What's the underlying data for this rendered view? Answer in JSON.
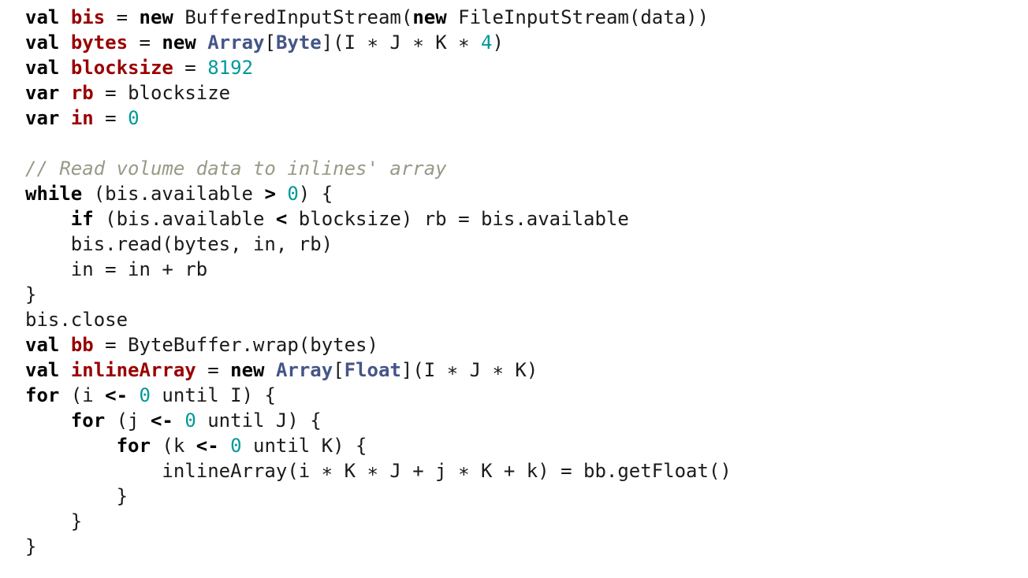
{
  "code": {
    "lines": [
      [
        {
          "t": "val",
          "c": "kw"
        },
        {
          "t": " ",
          "c": "tx"
        },
        {
          "t": "bis",
          "c": "id"
        },
        {
          "t": " = ",
          "c": "tx"
        },
        {
          "t": "new",
          "c": "kw"
        },
        {
          "t": " BufferedInputStream(",
          "c": "tx"
        },
        {
          "t": "new",
          "c": "kw"
        },
        {
          "t": " FileInputStream(data))",
          "c": "tx"
        }
      ],
      [
        {
          "t": "val",
          "c": "kw"
        },
        {
          "t": " ",
          "c": "tx"
        },
        {
          "t": "bytes",
          "c": "id"
        },
        {
          "t": " = ",
          "c": "tx"
        },
        {
          "t": "new",
          "c": "kw"
        },
        {
          "t": " ",
          "c": "tx"
        },
        {
          "t": "Array",
          "c": "ty"
        },
        {
          "t": "[",
          "c": "tx"
        },
        {
          "t": "Byte",
          "c": "ty"
        },
        {
          "t": "](I ∗ J ∗ K ∗ ",
          "c": "tx"
        },
        {
          "t": "4",
          "c": "num"
        },
        {
          "t": ")",
          "c": "tx"
        }
      ],
      [
        {
          "t": "val",
          "c": "kw"
        },
        {
          "t": " ",
          "c": "tx"
        },
        {
          "t": "blocksize",
          "c": "id"
        },
        {
          "t": " = ",
          "c": "tx"
        },
        {
          "t": "8192",
          "c": "num"
        }
      ],
      [
        {
          "t": "var",
          "c": "kw"
        },
        {
          "t": " ",
          "c": "tx"
        },
        {
          "t": "rb",
          "c": "id"
        },
        {
          "t": " = blocksize",
          "c": "tx"
        }
      ],
      [
        {
          "t": "var",
          "c": "kw"
        },
        {
          "t": " ",
          "c": "tx"
        },
        {
          "t": "in",
          "c": "id"
        },
        {
          "t": " = ",
          "c": "tx"
        },
        {
          "t": "0",
          "c": "num"
        }
      ],
      [],
      [
        {
          "t": "// Read volume data to inlines' array",
          "c": "cm"
        }
      ],
      [
        {
          "t": "while",
          "c": "kw"
        },
        {
          "t": " (bis.available ",
          "c": "tx"
        },
        {
          "t": ">",
          "c": "op"
        },
        {
          "t": " ",
          "c": "tx"
        },
        {
          "t": "0",
          "c": "num"
        },
        {
          "t": ") {",
          "c": "tx"
        }
      ],
      [
        {
          "t": "    ",
          "c": "tx"
        },
        {
          "t": "if",
          "c": "kw"
        },
        {
          "t": " (bis.available ",
          "c": "tx"
        },
        {
          "t": "<",
          "c": "op"
        },
        {
          "t": " blocksize) rb = bis.available",
          "c": "tx"
        }
      ],
      [
        {
          "t": "    bis.read(bytes, in, rb)",
          "c": "tx"
        }
      ],
      [
        {
          "t": "    in = in + rb",
          "c": "tx"
        }
      ],
      [
        {
          "t": "}",
          "c": "tx"
        }
      ],
      [
        {
          "t": "bis.close",
          "c": "tx"
        }
      ],
      [
        {
          "t": "val",
          "c": "kw"
        },
        {
          "t": " ",
          "c": "tx"
        },
        {
          "t": "bb",
          "c": "id"
        },
        {
          "t": " = ByteBuffer.wrap(bytes)",
          "c": "tx"
        }
      ],
      [
        {
          "t": "val",
          "c": "kw"
        },
        {
          "t": " ",
          "c": "tx"
        },
        {
          "t": "inlineArray",
          "c": "id"
        },
        {
          "t": " = ",
          "c": "tx"
        },
        {
          "t": "new",
          "c": "kw"
        },
        {
          "t": " ",
          "c": "tx"
        },
        {
          "t": "Array",
          "c": "ty"
        },
        {
          "t": "[",
          "c": "tx"
        },
        {
          "t": "Float",
          "c": "ty"
        },
        {
          "t": "](I ∗ J ∗ K)",
          "c": "tx"
        }
      ],
      [
        {
          "t": "for",
          "c": "kw"
        },
        {
          "t": " (i ",
          "c": "tx"
        },
        {
          "t": "<-",
          "c": "op"
        },
        {
          "t": " ",
          "c": "tx"
        },
        {
          "t": "0",
          "c": "num"
        },
        {
          "t": " until I) {",
          "c": "tx"
        }
      ],
      [
        {
          "t": "    ",
          "c": "tx"
        },
        {
          "t": "for",
          "c": "kw"
        },
        {
          "t": " (j ",
          "c": "tx"
        },
        {
          "t": "<-",
          "c": "op"
        },
        {
          "t": " ",
          "c": "tx"
        },
        {
          "t": "0",
          "c": "num"
        },
        {
          "t": " until J) {",
          "c": "tx"
        }
      ],
      [
        {
          "t": "        ",
          "c": "tx"
        },
        {
          "t": "for",
          "c": "kw"
        },
        {
          "t": " (k ",
          "c": "tx"
        },
        {
          "t": "<-",
          "c": "op"
        },
        {
          "t": " ",
          "c": "tx"
        },
        {
          "t": "0",
          "c": "num"
        },
        {
          "t": " until K) {",
          "c": "tx"
        }
      ],
      [
        {
          "t": "            inlineArray(i ∗ K ∗ J + j ∗ K + k) = bb.getFloat()",
          "c": "tx"
        }
      ],
      [
        {
          "t": "        }",
          "c": "tx"
        }
      ],
      [
        {
          "t": "    }",
          "c": "tx"
        }
      ],
      [
        {
          "t": "}",
          "c": "tx"
        }
      ]
    ]
  },
  "colors": {
    "background": "#ffffff",
    "keyword": "#000000",
    "identifier": "#990000",
    "type": "#445588",
    "number": "#009999",
    "comment": "#999988",
    "text": "#1a1a1a"
  }
}
